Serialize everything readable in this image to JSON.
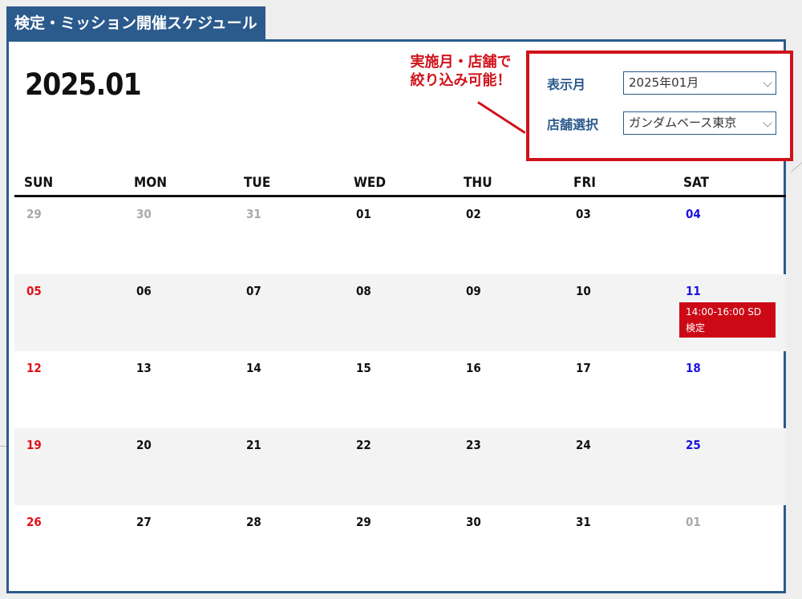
{
  "header": {
    "title": "検定・ミッション開催スケジュール"
  },
  "calendar_title": "2025.01",
  "annotation": {
    "line1": "実施月・店舗で",
    "line2": "絞り込み可能！"
  },
  "filters": {
    "month_label": "表示月",
    "month_value": "2025年01月",
    "store_label": "店舗選択",
    "store_value": "ガンダムベース東京"
  },
  "weekdays": [
    "SUN",
    "MON",
    "TUE",
    "WED",
    "THU",
    "FRI",
    "SAT"
  ],
  "weeks": [
    [
      {
        "d": "29",
        "kind": "other"
      },
      {
        "d": "30",
        "kind": "other"
      },
      {
        "d": "31",
        "kind": "other"
      },
      {
        "d": "01",
        "kind": "normal"
      },
      {
        "d": "02",
        "kind": "normal"
      },
      {
        "d": "03",
        "kind": "normal"
      },
      {
        "d": "04",
        "kind": "sat"
      }
    ],
    [
      {
        "d": "05",
        "kind": "sun"
      },
      {
        "d": "06",
        "kind": "normal"
      },
      {
        "d": "07",
        "kind": "normal"
      },
      {
        "d": "08",
        "kind": "normal"
      },
      {
        "d": "09",
        "kind": "normal"
      },
      {
        "d": "10",
        "kind": "normal"
      },
      {
        "d": "11",
        "kind": "sat",
        "event": "14:00-16:00 SD検定"
      }
    ],
    [
      {
        "d": "12",
        "kind": "sun"
      },
      {
        "d": "13",
        "kind": "normal"
      },
      {
        "d": "14",
        "kind": "normal"
      },
      {
        "d": "15",
        "kind": "normal"
      },
      {
        "d": "16",
        "kind": "normal"
      },
      {
        "d": "17",
        "kind": "normal"
      },
      {
        "d": "18",
        "kind": "sat"
      }
    ],
    [
      {
        "d": "19",
        "kind": "sun"
      },
      {
        "d": "20",
        "kind": "normal"
      },
      {
        "d": "21",
        "kind": "normal"
      },
      {
        "d": "22",
        "kind": "normal"
      },
      {
        "d": "23",
        "kind": "normal"
      },
      {
        "d": "24",
        "kind": "normal"
      },
      {
        "d": "25",
        "kind": "sat"
      }
    ],
    [
      {
        "d": "26",
        "kind": "sun"
      },
      {
        "d": "27",
        "kind": "normal"
      },
      {
        "d": "28",
        "kind": "normal"
      },
      {
        "d": "29",
        "kind": "normal"
      },
      {
        "d": "30",
        "kind": "normal"
      },
      {
        "d": "31",
        "kind": "normal"
      },
      {
        "d": "01",
        "kind": "other"
      }
    ]
  ],
  "colors": {
    "primary": "#2b5a8c",
    "accent": "#d0121b",
    "event_bg": "#cc0a16",
    "sunday": "#e0101a",
    "saturday": "#1a12e0",
    "other_month": "#aaaaaa"
  }
}
